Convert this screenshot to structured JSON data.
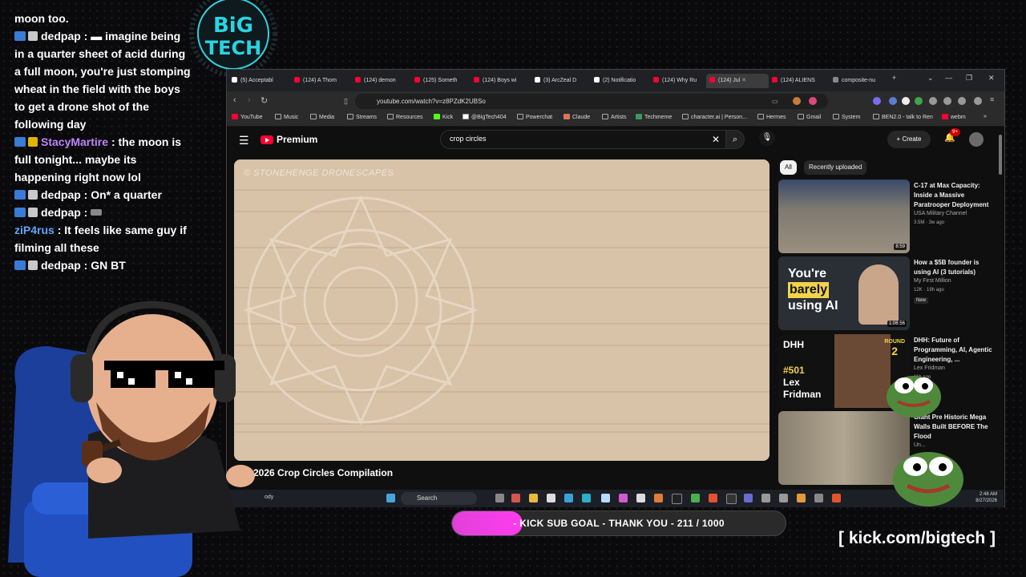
{
  "chat": {
    "partial_top": "moon too.",
    "messages": [
      {
        "user": "dedpap",
        "text": ": ▬ imagine being in a quarter sheet of acid during a full moon, you're just stomping wheat in the field with the boys to get a drone shot of the following day"
      },
      {
        "user": "StacyMartire",
        "text": ": the moon is full tonight... maybe its happening right now lol"
      },
      {
        "user": "dedpap",
        "text": ": On* a quarter"
      },
      {
        "user": "dedpap",
        "text": ":"
      },
      {
        "user": "ziP4rus",
        "text": ": It feels like same guy if filming all these"
      },
      {
        "user": "dedpap",
        "text": ": GN BT"
      }
    ]
  },
  "logo": {
    "line1": "BiG",
    "line2": "TECH"
  },
  "browser": {
    "tabs": [
      "(5) Acceptabl",
      "(124) A Thom",
      "(124) demon",
      "(125) Someth",
      "(124) Boys wi",
      "(3) ArcZeal D",
      "(2) Notificatio",
      "(124) Why Ru",
      "(124) Jul",
      "(124) ALIENS",
      "composite-nu"
    ],
    "url": "youtube.com/watch?v=z8PZdK2UBSo",
    "bookmarks": [
      "YouTube",
      "Music",
      "Media",
      "Streams",
      "Resources",
      "Kick",
      "@BigTech404",
      "Powerchat",
      "Claude",
      "Artists",
      "Techmeme",
      "character.ai | Person...",
      "Hermes",
      "Gmail",
      "System",
      "BEN2.0 - talk to Ren",
      "webm"
    ]
  },
  "youtube": {
    "brand": "Premium",
    "search_query": "crop circles",
    "create_label": "Create",
    "notification_count": "9+",
    "video_watermark": "© STONEHENGE DRONESCAPES",
    "video_title": "2026 Crop Circles Compilation",
    "chips": [
      "All",
      "Recently uploaded"
    ],
    "recommendations": [
      {
        "title": "C-17 at Max Capacity: Inside a Massive Paratrooper Deployment",
        "channel": "USA Military Channel",
        "meta": "3.5M · 3w ago",
        "duration": "8:59"
      },
      {
        "title": "How a $5B founder is using AI (3 tutorials)",
        "channel": "My First Million",
        "meta": "12K · 19h ago",
        "badge": "New",
        "duration": "1:06:56",
        "thumb_text": [
          "You're",
          "barely",
          "using AI"
        ]
      },
      {
        "title": "DHH: Future of Programming, AI, Agentic Engineering, ...",
        "channel": "Lex Fridman",
        "meta": "11h ago",
        "thumb_text": [
          "DHH",
          "#501",
          "Lex",
          "Fridman",
          "ROUND",
          "2"
        ]
      },
      {
        "title": "Giant Pre Historic Mega Walls Built BEFORE The Flood",
        "channel": "Un...",
        "meta": ""
      }
    ]
  },
  "taskbar": {
    "search": "Search",
    "time": "2:48 AM",
    "date": "8/27/2026",
    "left_label": "ody"
  },
  "overlay": {
    "goal_text": "- KICK SUB GOAL - THANK YOU - 211 / 1000",
    "goal_fraction": 0.211,
    "kick_link": "[ kick.com/bigtech ]"
  },
  "colors": {
    "youtube_red": "#ff0033",
    "goal_pink": "#e041d8",
    "chat_purple": "#c084fc",
    "chat_blue": "#60a5fa"
  }
}
